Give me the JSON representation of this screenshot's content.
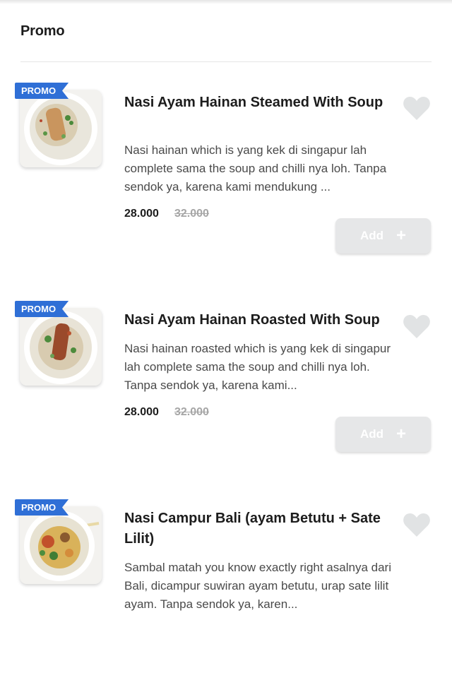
{
  "section": {
    "title": "Promo"
  },
  "colors": {
    "promo_badge": "#2f6fd6",
    "add_button_bg": "#e6e7e8",
    "heart": "#e1e3e4",
    "strike_price": "#a6a6a6"
  },
  "items": [
    {
      "badge": "PROMO",
      "name": "Nasi Ayam Hainan Steamed With Soup",
      "description": "Nasi hainan which is yang kek di singapur lah complete sama the soup and chilli nya loh. Tanpa sendok ya, karena kami mendukung ...",
      "price": "28.000",
      "original_price": "32.000",
      "add_label": "Add",
      "favorite_icon": "heart-icon",
      "add_icon": "plus-icon"
    },
    {
      "badge": "PROMO",
      "name": "Nasi Ayam Hainan Roasted With Soup",
      "description": "Nasi hainan roasted which is yang kek di singapur lah complete sama the soup and chilli nya loh. Tanpa sendok ya, karena kami...",
      "price": "28.000",
      "original_price": "32.000",
      "add_label": "Add",
      "favorite_icon": "heart-icon",
      "add_icon": "plus-icon"
    },
    {
      "badge": "PROMO",
      "name": "Nasi Campur Bali (ayam Betutu + Sate Lilit)",
      "description": "Sambal matah you know exactly right asalnya dari Bali, dicampur suwiran ayam betutu, urap sate lilit ayam. Tanpa sendok ya, karen...",
      "favorite_icon": "heart-icon"
    }
  ]
}
